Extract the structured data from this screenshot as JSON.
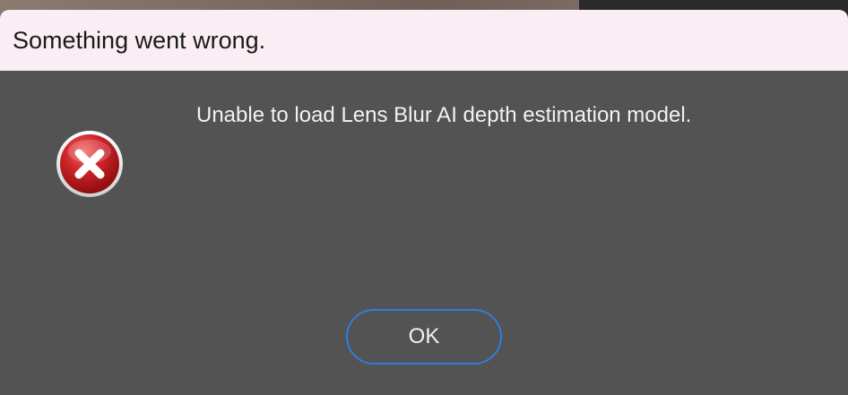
{
  "dialog": {
    "title": "Something went wrong.",
    "message": "Unable to load Lens Blur AI depth estimation model.",
    "icon": "error-icon",
    "ok_label": "OK"
  },
  "colors": {
    "titlebar_bg": "#faeef4",
    "dialog_bg": "#535353",
    "button_border": "#2f7ddb",
    "error_red": "#c8161d"
  }
}
